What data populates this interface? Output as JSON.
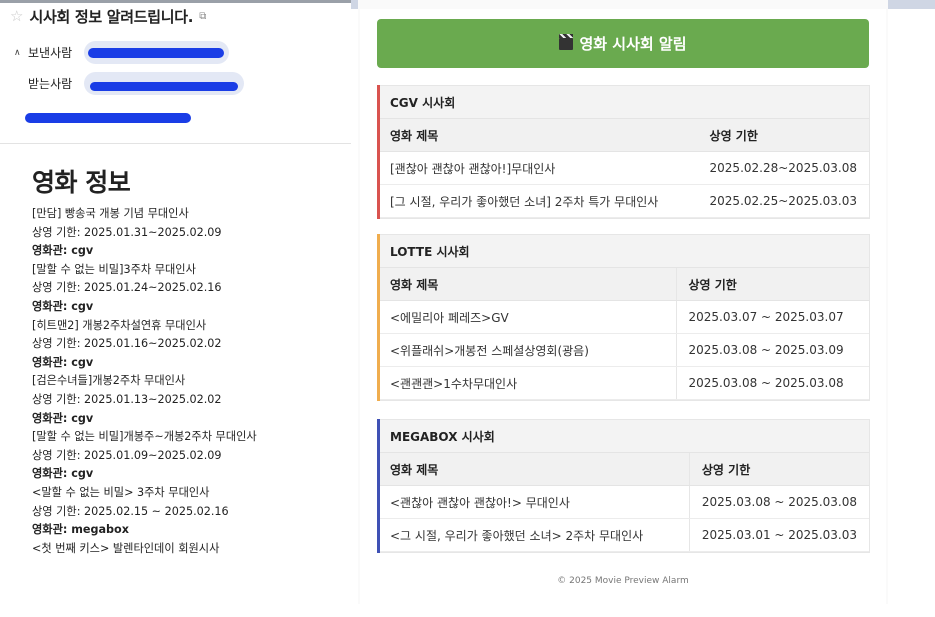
{
  "email": {
    "subject": "시사회 정보 알려드립니다.",
    "sender_label": "보낸사람",
    "recipient_label": "받는사람"
  },
  "left": {
    "heading": "영화 정보",
    "lines": [
      {
        "text": "[만담] 빵송국 개봉 기념 무대인사",
        "bold": false
      },
      {
        "text": "상영 기한: 2025.01.31~2025.02.09",
        "bold": false
      },
      {
        "text": "영화관: cgv",
        "bold": true
      },
      {
        "text": "[말할 수 없는 비밀]3주차 무대인사",
        "bold": false
      },
      {
        "text": "상영 기한: 2025.01.24~2025.02.16",
        "bold": false
      },
      {
        "text": "영화관: cgv",
        "bold": true
      },
      {
        "text": "[히트맨2] 개봉2주차설연휴 무대인사",
        "bold": false
      },
      {
        "text": "상영 기한: 2025.01.16~2025.02.02",
        "bold": false
      },
      {
        "text": "영화관: cgv",
        "bold": true
      },
      {
        "text": "[검은수녀들]개봉2주차 무대인사",
        "bold": false
      },
      {
        "text": "상영 기한: 2025.01.13~2025.02.02",
        "bold": false
      },
      {
        "text": "영화관: cgv",
        "bold": true
      },
      {
        "text": "[말할 수 없는 비밀]개봉주~개봉2주차 무대인사",
        "bold": false
      },
      {
        "text": "상영 기한: 2025.01.09~2025.02.09",
        "bold": false
      },
      {
        "text": "영화관: cgv",
        "bold": true
      },
      {
        "text": "<말할 수 없는 비밀> 3주차 무대인사",
        "bold": false
      },
      {
        "text": "상영 기한: 2025.02.15 ~ 2025.02.16",
        "bold": false
      },
      {
        "text": "영화관: megabox",
        "bold": true
      },
      {
        "text": "<첫 번째 키스> 발렌타인데이 회원시사",
        "bold": false
      }
    ]
  },
  "right": {
    "banner_title": "영화 시사회 알림",
    "sections": [
      {
        "title": "CGV 시사회",
        "accent": "#d9534f",
        "col_title": "영화 제목",
        "col_period": "상영 기한",
        "rows": [
          {
            "title": "[괜찮아 괜찮아 괜찮아!]무대인사",
            "period": "2025.02.28~2025.03.08"
          },
          {
            "title": "[그 시절, 우리가 좋아했던 소녀] 2주차 특가 무대인사",
            "period": "2025.02.25~2025.03.03"
          }
        ]
      },
      {
        "title": "LOTTE 시사회",
        "accent": "#f0ad4e",
        "col_title": "영화 제목",
        "col_period": "상영 기한",
        "rows": [
          {
            "title": "<에밀리아 페레즈>GV",
            "period": "2025.03.07 ~ 2025.03.07"
          },
          {
            "title": "<위플래쉬>개봉전 스페셜상영회(광음)",
            "period": "2025.03.08 ~ 2025.03.09"
          },
          {
            "title": "<괜괜괜>1수차무대인사",
            "period": "2025.03.08 ~ 2025.03.08"
          }
        ]
      },
      {
        "title": "MEGABOX 시사회",
        "accent": "#3f51b5",
        "col_title": "영화 제목",
        "col_period": "상영 기한",
        "rows": [
          {
            "title": "<괜찮아 괜찮아 괜찮아!> 무대인사",
            "period": "2025.03.08 ~ 2025.03.08"
          },
          {
            "title": "<그 시절, 우리가 좋아했던 소녀> 2주차 무대인사",
            "period": "2025.03.01 ~ 2025.03.03"
          }
        ]
      }
    ],
    "footer": "© 2025 Movie Preview Alarm"
  }
}
